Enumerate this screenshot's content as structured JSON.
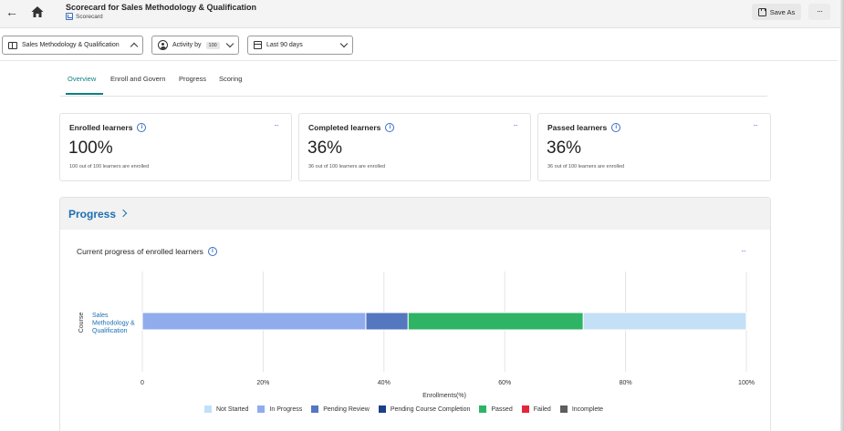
{
  "header": {
    "title": "Scorecard for Sales Methodology & Qualification",
    "subtitle": "Scorecard",
    "save_as": "Save As",
    "more": "···"
  },
  "filters": {
    "course": "Sales Methodology & Qualification",
    "activity_label": "Activity by",
    "activity_count": "100",
    "date_range": "Last 90 days"
  },
  "tabs": [
    "Overview",
    "Enroll and Govern",
    "Progress",
    "Scoring"
  ],
  "kpis": [
    {
      "title": "Enrolled learners",
      "value": "100%",
      "note": "100 out of 100 learners are enrolled"
    },
    {
      "title": "Completed learners",
      "value": "36%",
      "note": "36 out of 100 learners are enrolled"
    },
    {
      "title": "Passed learners",
      "value": "36%",
      "note": "36 out of 100 learners are enrolled"
    }
  ],
  "progress": {
    "section_title": "Progress",
    "chart_title": "Current progress of enrolled learners"
  },
  "chart_data": {
    "type": "bar",
    "orientation": "horizontal",
    "stacked": true,
    "title": "Current progress of enrolled learners",
    "xlabel": "Enrollments(%)",
    "ylabel": "Course",
    "xlim": [
      0,
      100
    ],
    "x_ticks": [
      "0",
      "20%",
      "40%",
      "60%",
      "80%",
      "100%"
    ],
    "grid": true,
    "legend_position": "bottom",
    "categories": [
      "Sales Methodology & Qualification"
    ],
    "category_lines": [
      "Sales",
      "Methodology &",
      "Qualification"
    ],
    "series": [
      {
        "name": "Not Started",
        "color": "#c4e0f6",
        "values": [
          27
        ]
      },
      {
        "name": "In Progress",
        "color": "#90acec",
        "values": [
          37
        ]
      },
      {
        "name": "Pending Review",
        "color": "#5577c0",
        "values": [
          7
        ]
      },
      {
        "name": "Pending Course Completion",
        "color": "#1d3f8a",
        "values": [
          0
        ]
      },
      {
        "name": "Passed",
        "color": "#2fb466",
        "values": [
          29
        ]
      },
      {
        "name": "Failed",
        "color": "#e3273d",
        "values": [
          0
        ]
      },
      {
        "name": "Incomplete",
        "color": "#5e5e5e",
        "values": [
          0
        ]
      }
    ],
    "stack_order": [
      "In Progress",
      "Pending Review",
      "Pending Course Completion",
      "Passed",
      "Failed",
      "Incomplete",
      "Not Started"
    ]
  }
}
